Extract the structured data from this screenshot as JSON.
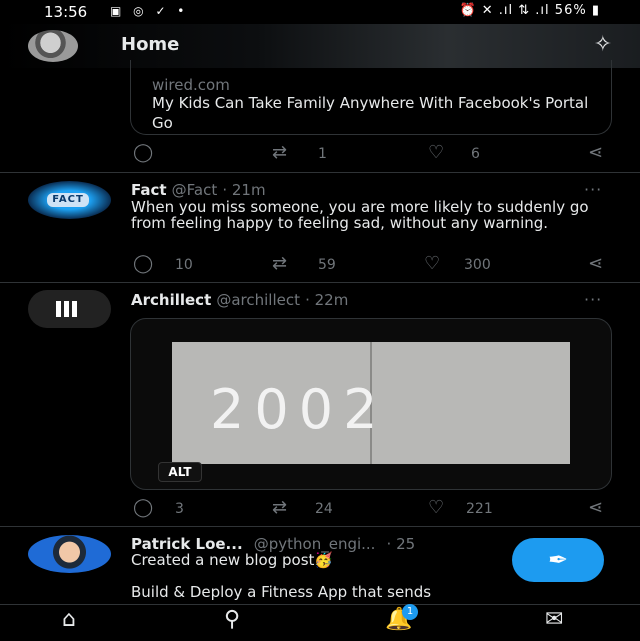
{
  "status_bar": {
    "time": "13:56",
    "left_icons": "▣ ◎ ✓ •",
    "right_icons": "⏰ ✕ .ıl ⇅ .ıl",
    "battery": "56%"
  },
  "header": {
    "title": "Home",
    "sparkle_icon": "✧"
  },
  "tweets": [
    {
      "card_domain": "wired.com",
      "card_title": "My Kids Can Take Family Anywhere With Facebook's Portal Go",
      "reply_count": "",
      "retweet_count": "1",
      "like_count": "6"
    },
    {
      "name": "Fact",
      "handle": "@Fact",
      "time": "· 21m",
      "avatar_badge": "FACT",
      "body": "When you miss someone, you are more likely to suddenly go from feeling happy to feeling sad, without any warning.",
      "reply_count": "10",
      "retweet_count": "59",
      "like_count": "300"
    },
    {
      "name": "Archillect",
      "handle": "@archillect",
      "time": "· 22m",
      "media_text": "2002",
      "media_badge": "ALT",
      "reply_count": "3",
      "retweet_count": "24",
      "like_count": "221"
    },
    {
      "name": "Patrick Loe...",
      "handle": "@python_engi...",
      "time": "· 25",
      "body_line1": "Created a new blog post🥳",
      "body_line2": "Build & Deploy a Fitness App that sends"
    }
  ],
  "more_icon": "···",
  "icons": {
    "reply": "◯",
    "retweet": "⇄",
    "like": "♡",
    "share": "⋖"
  },
  "fab_icon": "✒",
  "bottom_nav": {
    "home_icon": "⌂",
    "search_icon": "⚲",
    "notifications_icon": "🔔",
    "notifications_badge": "1",
    "messages_icon": "✉"
  },
  "colors": {
    "accent": "#1d9bf0",
    "background": "#000000",
    "secondary_text": "#71767b"
  }
}
